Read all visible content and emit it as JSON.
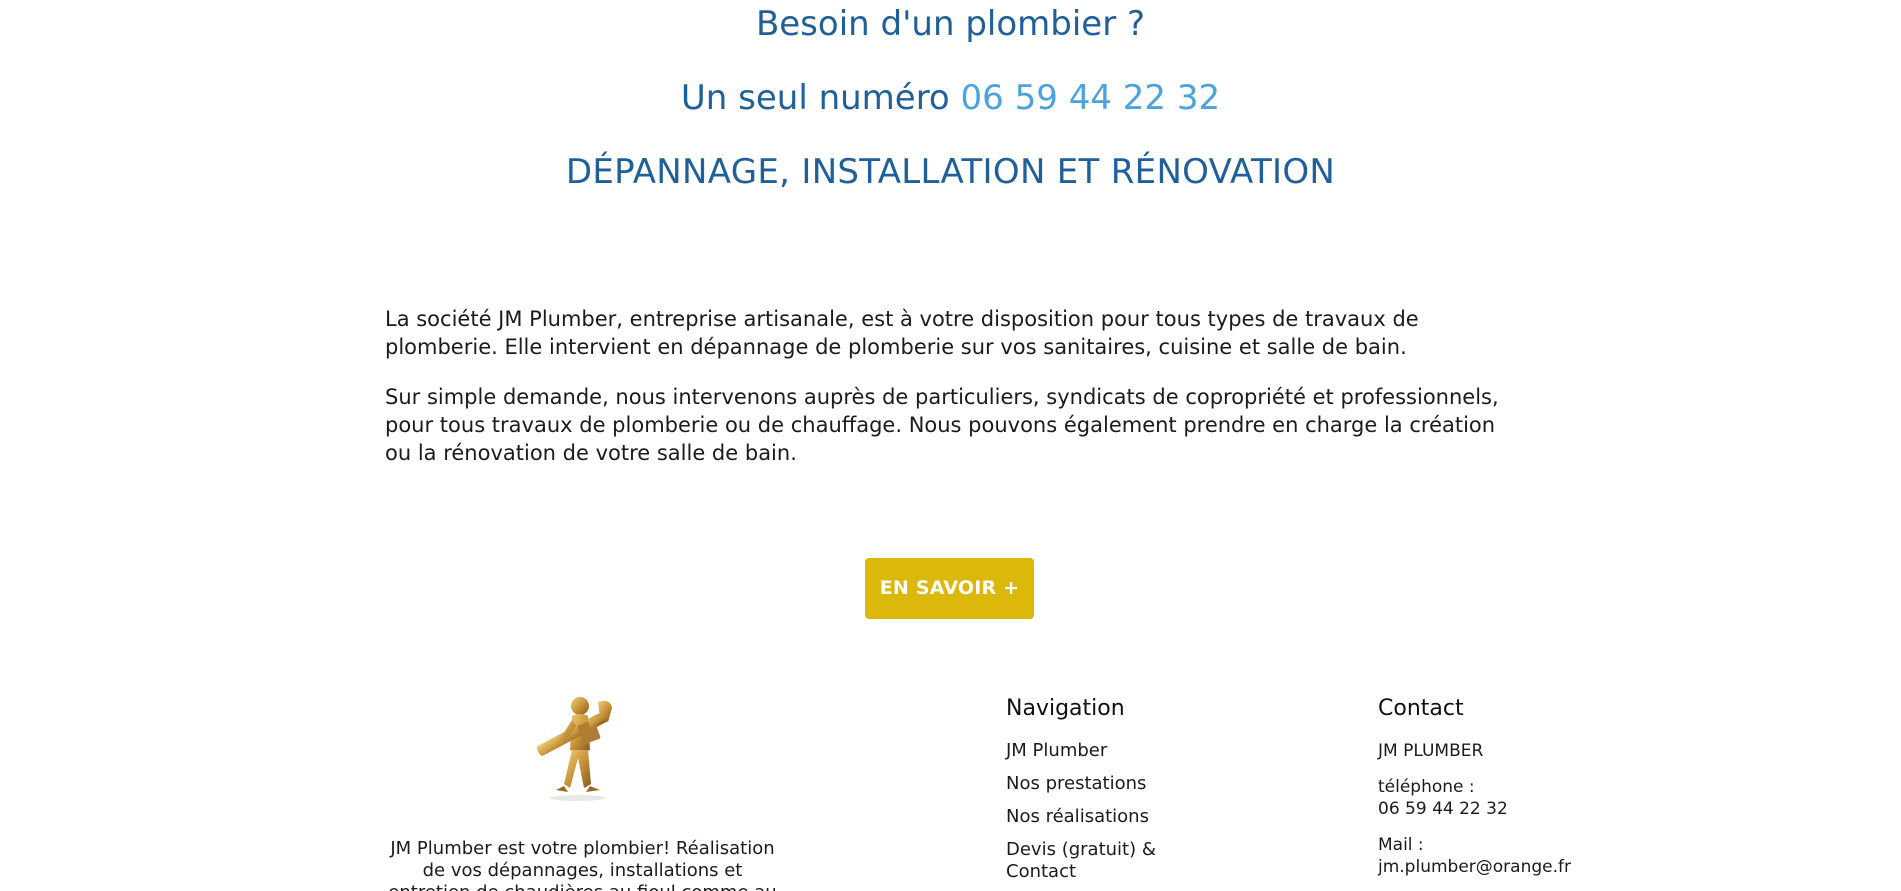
{
  "hero": {
    "line1": "Besoin d'un plombier ?",
    "line2_prefix": "Un seul numéro ",
    "phone": "06 59 44 22 32",
    "line3": "DÉPANNAGE, INSTALLATION ET RÉNOVATION"
  },
  "intro": {
    "p1": "La société JM Plumber, entreprise artisanale, est à votre disposition pour tous types de travaux de plomberie. Elle intervient en dépannage de plomberie sur vos sanitaires, cuisine et salle de bain.",
    "p2": "Sur simple demande, nous intervenons auprès de particuliers, syndicats de copropriété et professionnels, pour tous travaux de plomberie ou de chauffage. Nous pouvons également prendre en charge la création ou la rénovation de votre salle de bain."
  },
  "cta": {
    "label": "EN SAVOIR +"
  },
  "footer": {
    "about": "JM Plumber est votre plombier! Réalisation de vos dépannages, installations et entretien de chaudières au fioul comme au",
    "navigation": {
      "title": "Navigation",
      "items": [
        {
          "label": "JM Plumber"
        },
        {
          "label": "Nos prestations"
        },
        {
          "label": "Nos réalisations"
        },
        {
          "label": "Devis (gratuit) & Contact"
        }
      ]
    },
    "contact": {
      "title": "Contact",
      "company": "JM PLUMBER",
      "phone_label": "téléphone :",
      "phone": "06 59 44 22 32",
      "mail_label": "Mail :",
      "email": "jm.plumber@orange.fr"
    }
  },
  "colors": {
    "heading_blue": "#1f5f9a",
    "phone_blue": "#4aa3de",
    "cta_gold": "#dcb80a"
  },
  "icons": {
    "logo": "golden-plumber-figure-icon"
  }
}
